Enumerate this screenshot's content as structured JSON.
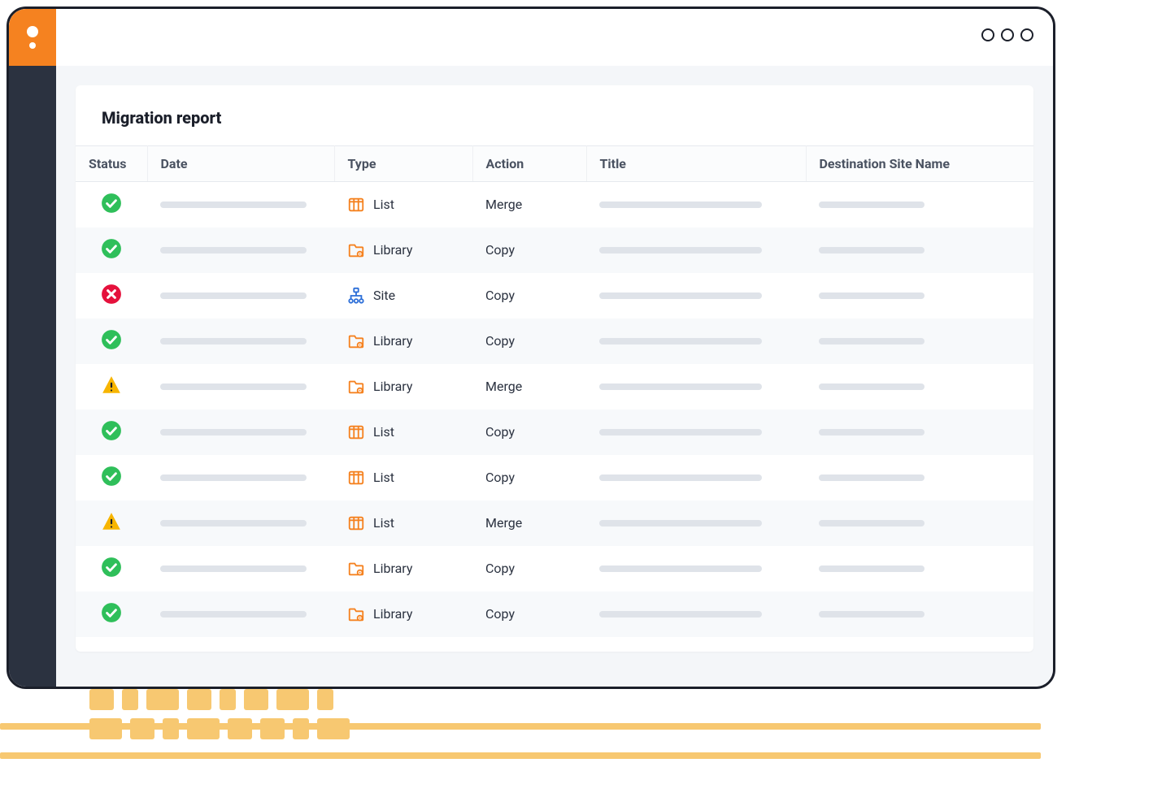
{
  "page": {
    "title": "Migration report"
  },
  "columns": {
    "status": "Status",
    "date": "Date",
    "type": "Type",
    "action": "Action",
    "title": "Title",
    "destination": "Destination Site Name"
  },
  "rows": [
    {
      "status": "success",
      "type": "List",
      "type_icon": "list",
      "action": "Merge"
    },
    {
      "status": "success",
      "type": "Library",
      "type_icon": "library",
      "action": "Copy"
    },
    {
      "status": "error",
      "type": "Site",
      "type_icon": "site",
      "action": "Copy"
    },
    {
      "status": "success",
      "type": "Library",
      "type_icon": "library",
      "action": "Copy"
    },
    {
      "status": "warning",
      "type": "Library",
      "type_icon": "library",
      "action": "Merge"
    },
    {
      "status": "success",
      "type": "List",
      "type_icon": "list",
      "action": "Copy"
    },
    {
      "status": "success",
      "type": "List",
      "type_icon": "list",
      "action": "Copy"
    },
    {
      "status": "warning",
      "type": "List",
      "type_icon": "list",
      "action": "Merge"
    },
    {
      "status": "success",
      "type": "Library",
      "type_icon": "library",
      "action": "Copy"
    },
    {
      "status": "success",
      "type": "Library",
      "type_icon": "library",
      "action": "Copy"
    }
  ],
  "colors": {
    "success": "#2fbf5a",
    "error": "#e5113c",
    "warning": "#f7b500",
    "list_icon": "#f58220",
    "library_icon": "#f58220",
    "site_icon": "#2d6fd8"
  }
}
